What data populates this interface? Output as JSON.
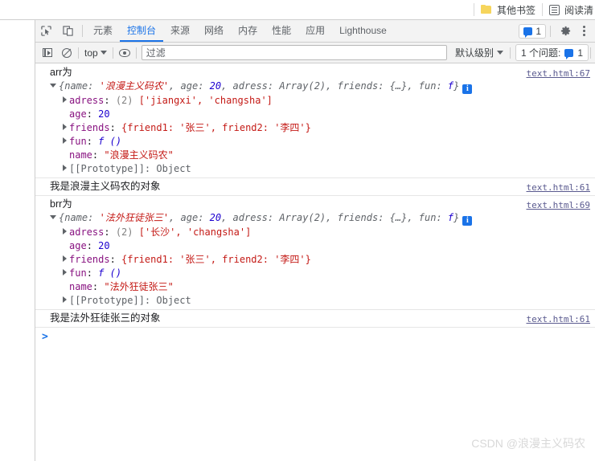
{
  "browser": {
    "bookmarks": [
      {
        "label": "其他书签",
        "icon": "folder-icon"
      },
      {
        "label": "阅读清",
        "icon": "reading-list-icon"
      }
    ]
  },
  "devtools": {
    "tabs": [
      {
        "label": "元素",
        "active": false
      },
      {
        "label": "控制台",
        "active": true
      },
      {
        "label": "来源",
        "active": false
      },
      {
        "label": "网络",
        "active": false
      },
      {
        "label": "内存",
        "active": false
      },
      {
        "label": "性能",
        "active": false
      },
      {
        "label": "应用",
        "active": false
      },
      {
        "label": "Lighthouse",
        "active": false
      }
    ],
    "message_badge_count": "1",
    "icons": {
      "inspect": "inspect-icon",
      "device": "device-toolbar-icon",
      "gear": "gear-icon",
      "kebab": "more-options-icon"
    },
    "filterbar": {
      "sidebar_toggle": "console-sidebar-icon",
      "clear": "clear-console-icon",
      "context": "top",
      "eye": "live-expression-icon",
      "filter_placeholder": "过滤",
      "filter_value": "",
      "level": "默认级别",
      "issues_label": "1 个问题:",
      "issues_count": "1"
    },
    "accent_color": "#1a73e8"
  },
  "console": {
    "messages": [
      {
        "label": "arr为",
        "source": "text.html:67",
        "preview": {
          "name_key": "name",
          "name_value": "'浪漫主义码农'",
          "age_key": "age",
          "age_value": "20",
          "adress_key": "adress",
          "adress_value": "Array(2)",
          "friends_key": "friends",
          "friends_value": "{…}",
          "fun_key": "fun",
          "fun_value": "f"
        },
        "props": [
          {
            "key": "adress",
            "count": "(2)",
            "value": "['jiangxi', 'changsha']",
            "expandable": true
          },
          {
            "key": "age",
            "value": "20",
            "expandable": false
          },
          {
            "key": "friends",
            "value": "{friend1: '张三', friend2: '李四'}",
            "expandable": true
          },
          {
            "key": "fun",
            "value": "f ()",
            "expandable": true
          },
          {
            "key": "name",
            "value": "\"浪漫主义码农\"",
            "expandable": false
          },
          {
            "key": "[[Prototype]]",
            "value": "Object",
            "expandable": true
          }
        ]
      },
      {
        "label": "我是浪漫主义码农的对象",
        "source": "text.html:61"
      },
      {
        "label": "brr为",
        "source": "text.html:69",
        "preview": {
          "name_key": "name",
          "name_value": "'法外狂徒张三'",
          "age_key": "age",
          "age_value": "20",
          "adress_key": "adress",
          "adress_value": "Array(2)",
          "friends_key": "friends",
          "friends_value": "{…}",
          "fun_key": "fun",
          "fun_value": "f"
        },
        "props": [
          {
            "key": "adress",
            "count": "(2)",
            "value": "['长沙', 'changsha']",
            "expandable": true
          },
          {
            "key": "age",
            "value": "20",
            "expandable": false
          },
          {
            "key": "friends",
            "value": "{friend1: '张三', friend2: '李四'}",
            "expandable": true
          },
          {
            "key": "fun",
            "value": "f ()",
            "expandable": true
          },
          {
            "key": "name",
            "value": "\"法外狂徒张三\"",
            "expandable": false
          },
          {
            "key": "[[Prototype]]",
            "value": "Object",
            "expandable": true
          }
        ]
      },
      {
        "label": "我是法外狂徒张三的对象",
        "source": "text.html:61"
      }
    ],
    "prompt_caret": ">"
  },
  "watermark": "CSDN @浪漫主义码农",
  "strings": {
    "adress_label": "adress:",
    "age_label": "age:",
    "friends_label": "friends:",
    "fun_label": "fun:",
    "name_label": "name:",
    "proto_label": "[[Prototype]]:",
    "obj_open": "{",
    "obj_close": "}",
    "comma": ", ",
    "colon": ": "
  }
}
